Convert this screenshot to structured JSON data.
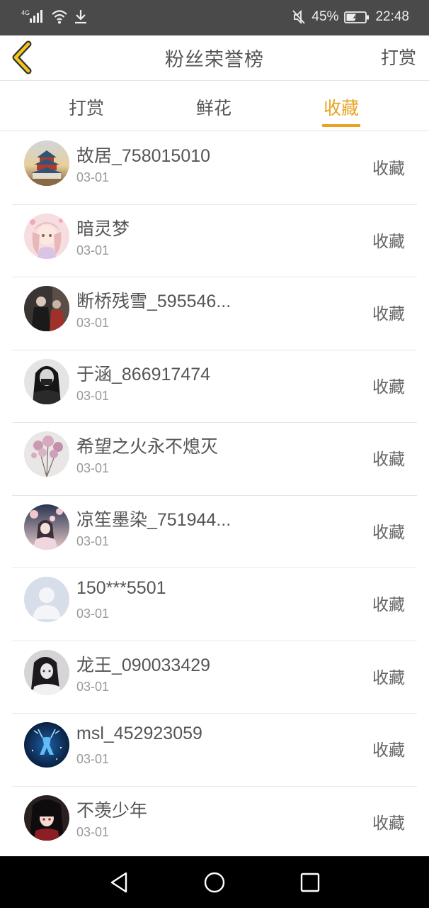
{
  "status_bar": {
    "network": "4G",
    "battery": "45%",
    "time": "22:48",
    "icons": [
      "signal-icon",
      "wifi-icon",
      "download-icon",
      "mute-icon",
      "battery-icon"
    ]
  },
  "header": {
    "title": "粉丝荣誉榜",
    "action_label": "打赏"
  },
  "tabs": [
    {
      "label": "打赏",
      "active": false
    },
    {
      "label": "鲜花",
      "active": false
    },
    {
      "label": "收藏",
      "active": true
    }
  ],
  "accent_color": "#e8a323",
  "fans": [
    {
      "name": "故居_758015010",
      "date": "03-01",
      "type": "收藏",
      "avatar": "temple"
    },
    {
      "name": "暗灵梦",
      "date": "03-01",
      "type": "收藏",
      "avatar": "anime-pink"
    },
    {
      "name": "断桥残雪_595546...",
      "date": "03-01",
      "type": "收藏",
      "avatar": "dark-figure"
    },
    {
      "name": "于涵_866917474",
      "date": "03-01",
      "type": "收藏",
      "avatar": "bw-portrait"
    },
    {
      "name": "希望之火永不熄灭",
      "date": "03-01",
      "type": "收藏",
      "avatar": "flowers"
    },
    {
      "name": "凉笙墨染_751944...",
      "date": "03-01",
      "type": "收藏",
      "avatar": "blossom"
    },
    {
      "name": "150***5501",
      "date": "03-01",
      "type": "收藏",
      "avatar": "default"
    },
    {
      "name": "龙王_090033429",
      "date": "03-01",
      "type": "收藏",
      "avatar": "gray-girl"
    },
    {
      "name": "msl_452923059",
      "date": "03-01",
      "type": "收藏",
      "avatar": "blue-deer"
    },
    {
      "name": "不羡少年",
      "date": "03-01",
      "type": "收藏",
      "avatar": "anime-dark"
    }
  ],
  "nav": [
    "back-nav-icon",
    "home-nav-icon",
    "recents-nav-icon"
  ]
}
